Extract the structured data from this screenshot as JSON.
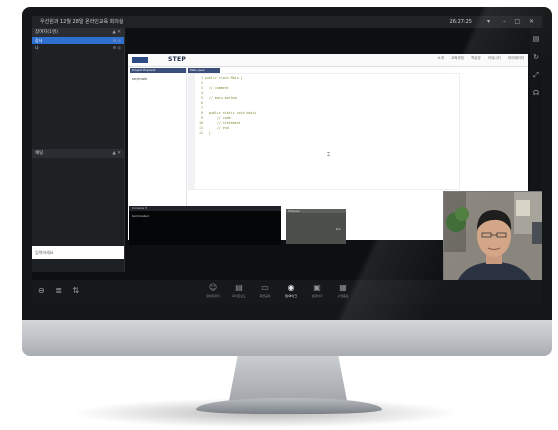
{
  "window": {
    "title": "우선원과 12월 28일 온라인교육 회의실",
    "time": "26:27:25",
    "controls": [
      "▾",
      "–",
      "□",
      "✕"
    ]
  },
  "left_panel": {
    "participants_header": "참여자(1명)",
    "participants": [
      {
        "name": "강사",
        "tag": "⚙ ◎"
      },
      {
        "name": "나",
        "tag": "⚙ ◎"
      }
    ],
    "chat_header": "채팅",
    "chat_input_placeholder": "입력하세요"
  },
  "shared_screen": {
    "logo_text": "STEP",
    "nav": [
      "소개",
      "교육과정",
      "학습방",
      "커뮤니티",
      "마이페이지"
    ],
    "tree_header": "Project Explorer",
    "tree_items": [
      "src/main"
    ],
    "editor_tab": "Main.java",
    "code": "  1 public class Main {\n  2\n  3   // comment\n  4\n  5   // main method\n  6\n  7\n  8   public static void main(\n  9       // code\n 10       // statement\n 11       // end\n 12   }",
    "console_label": "Console  ✕",
    "console_line": "terminated",
    "preview_label": "Preview",
    "preview_link": "link"
  },
  "toolbar": {
    "left_icons": [
      "⊖",
      "≣",
      "⇅"
    ],
    "tools": [
      {
        "icon": "☺",
        "label": "참여자관리"
      },
      {
        "icon": "▤",
        "label": "화이트보드"
      },
      {
        "icon": "▭",
        "label": "화면공유"
      },
      {
        "icon": "◉",
        "label": "캠/마이크"
      },
      {
        "icon": "▣",
        "label": "설정하기"
      },
      {
        "icon": "▦",
        "label": "수업종료"
      }
    ]
  },
  "right_rail": {
    "icons": [
      "doc-icon",
      "refresh-icon",
      "expand-icon",
      "headset-icon"
    ]
  },
  "colors": {
    "accent": "#2f6fd0",
    "bezel": "#151617",
    "chin": "#c9ccd0"
  }
}
